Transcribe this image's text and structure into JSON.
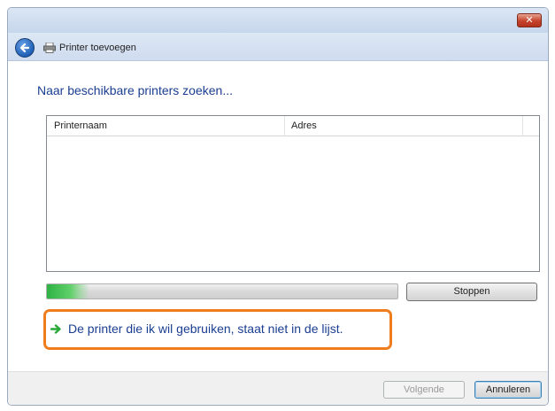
{
  "window": {
    "close_label": "✕"
  },
  "nav": {
    "title": "Printer toevoegen",
    "back_icon": "back-arrow-icon",
    "printer_icon": "printer-icon"
  },
  "main": {
    "heading": "Naar beschikbare printers zoeken...",
    "list": {
      "columns": [
        "Printernaam",
        "Adres"
      ],
      "rows": []
    },
    "progress_fraction": 0.12,
    "stop_label": "Stoppen",
    "link_text": "De printer die ik wil gebruiken, staat niet in de lijst."
  },
  "footer": {
    "next_label": "Volgende",
    "cancel_label": "Annuleren"
  },
  "colors": {
    "accent_text": "#1a3e91",
    "highlight_border": "#f07d1d",
    "progress_green": "#2fb244"
  }
}
